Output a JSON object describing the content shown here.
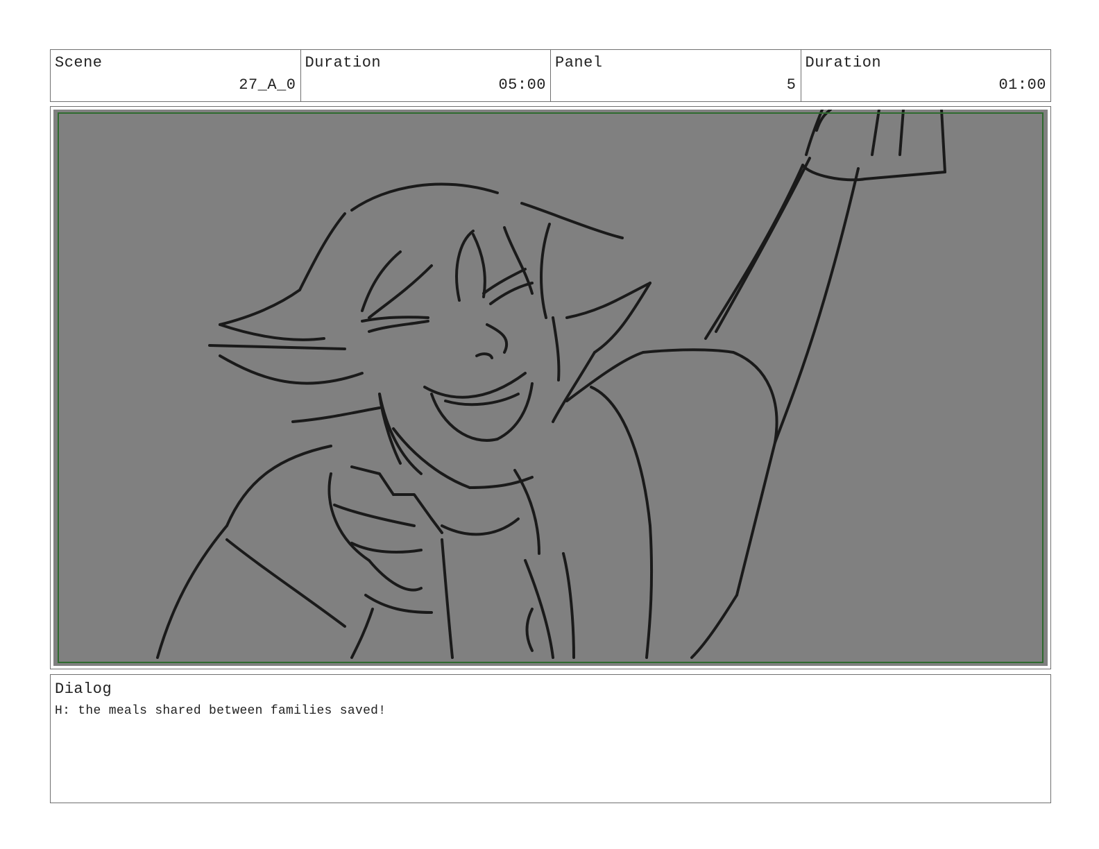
{
  "header": {
    "scene": {
      "label": "Scene",
      "value": "27_A_0"
    },
    "scene_duration": {
      "label": "Duration",
      "value": "05:00"
    },
    "panel": {
      "label": "Panel",
      "value": "5"
    },
    "panel_duration": {
      "label": "Duration",
      "value": "01:00"
    }
  },
  "frame": {
    "background_color": "#808080",
    "safe_area_color": "#2e6b2e",
    "line_color": "#1a1a1a"
  },
  "dialog": {
    "label": "Dialog",
    "text": "H: the meals shared between families saved!"
  }
}
